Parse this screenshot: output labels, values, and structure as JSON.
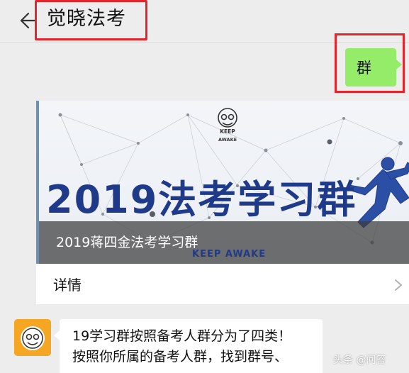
{
  "header": {
    "title": "觉晓法考",
    "back_icon": "back-arrow-icon"
  },
  "messages": {
    "sent": {
      "text": "群",
      "bubble_color": "#95ec69"
    },
    "card": {
      "banner_logo_text_top": "KEEP",
      "banner_logo_text_bottom": "AWAKE",
      "banner_headline": "2019法考学习群",
      "banner_footer_text": "KEEP AWAKE",
      "caption": "2019蒋四金法考学习群",
      "details_label": "详情",
      "details_icon": "chevron-right-icon"
    },
    "received": {
      "lines": [
        "19学习群按照备考人群分为了四类！",
        "按照你所属的备考人群，找到群号、"
      ]
    }
  },
  "watermark": "头条 @问答",
  "colors": {
    "highlight_border": "#e3262b",
    "banner_headline": "#1f3a88",
    "avatar_bg": "#f5a623"
  }
}
